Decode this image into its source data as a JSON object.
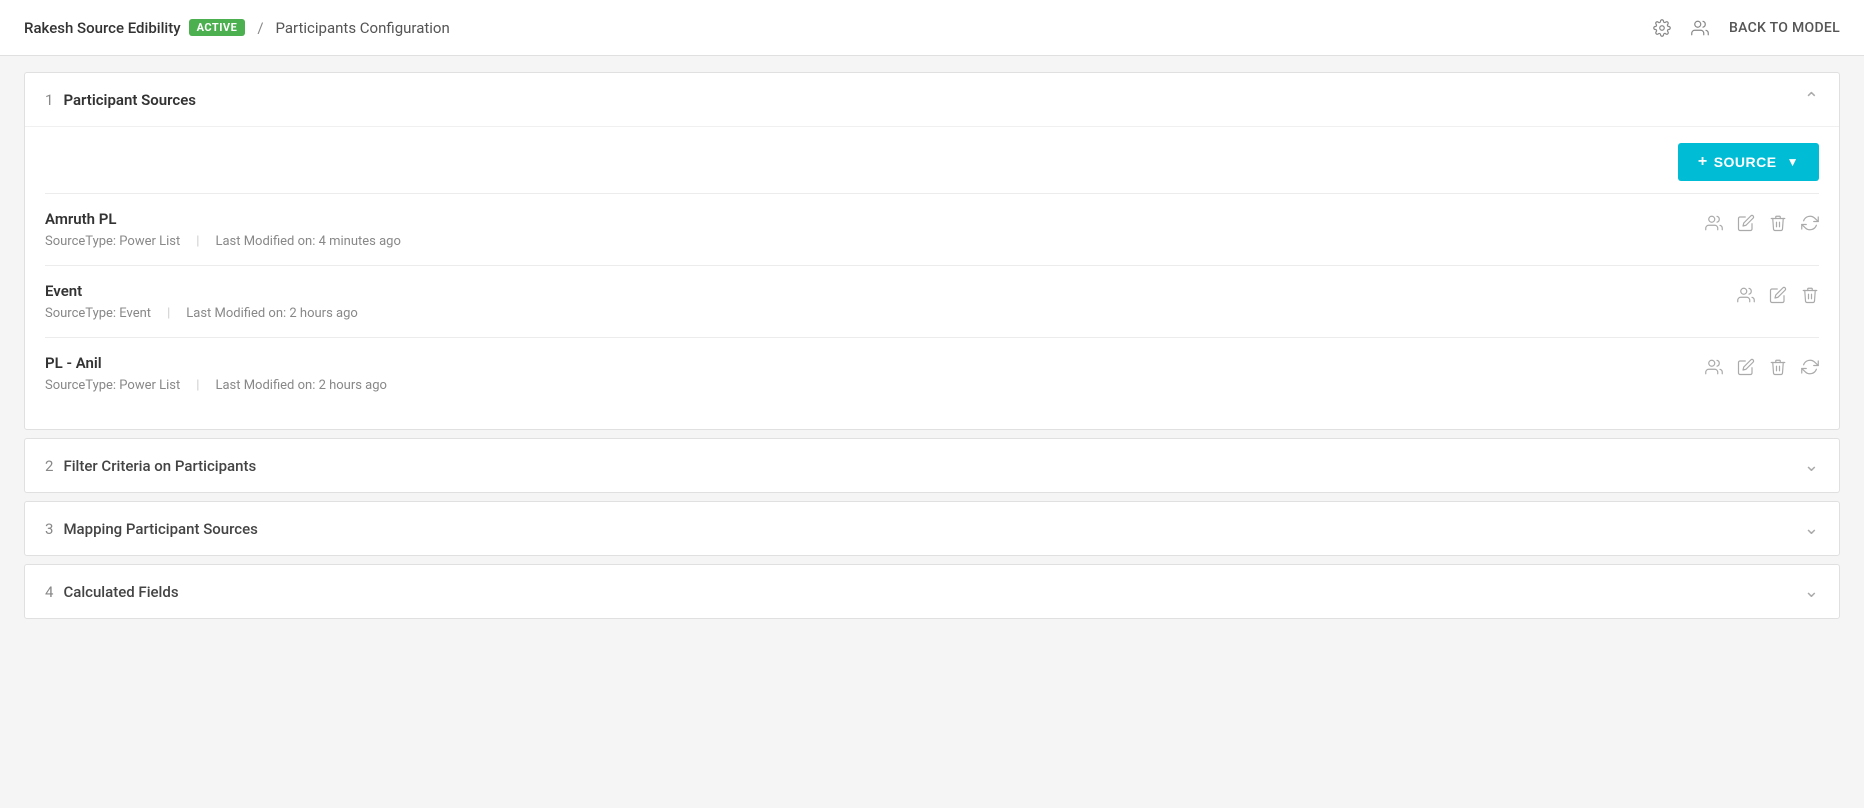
{
  "header": {
    "app_name": "Rakesh Source Edibility",
    "status_badge": "ACTIVE",
    "breadcrumb_sep": "/",
    "page_name": "Participants Configuration",
    "back_label": "BACK TO MODEL",
    "settings_icon": "gear-icon",
    "users_icon": "users-icon"
  },
  "sections": [
    {
      "number": "1",
      "title": "Participant Sources",
      "expanded": true,
      "add_source_label": "+ SOURCE",
      "sources": [
        {
          "name": "Amruth PL",
          "source_type_label": "SourceType: Power List",
          "last_modified": "Last Modified on: 4 minutes ago"
        },
        {
          "name": "Event",
          "source_type_label": "SourceType: Event",
          "last_modified": "Last Modified on: 2 hours ago"
        },
        {
          "name": "PL - Anil",
          "source_type_label": "SourceType: Power List",
          "last_modified": "Last Modified on: 2 hours ago"
        }
      ]
    },
    {
      "number": "2",
      "title": "Filter Criteria on Participants",
      "expanded": false
    },
    {
      "number": "3",
      "title": "Mapping Participant Sources",
      "expanded": false
    },
    {
      "number": "4",
      "title": "Calculated Fields",
      "expanded": false
    }
  ],
  "colors": {
    "active_badge_bg": "#4caf50",
    "add_source_btn": "#00bcd4",
    "icon_color": "#aaa",
    "text_primary": "#333",
    "text_secondary": "#888"
  }
}
